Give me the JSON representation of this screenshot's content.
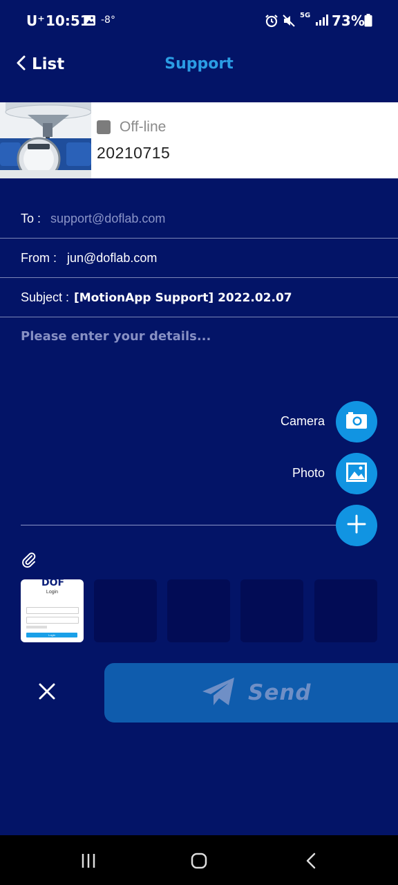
{
  "status_bar": {
    "carrier": "U⁺",
    "time": "10:51",
    "temperature": "-8°",
    "network": "5G",
    "battery": "73%"
  },
  "header": {
    "back_label": "List",
    "title": "Support"
  },
  "device": {
    "status": "Off-line",
    "id": "20210715"
  },
  "form": {
    "to_label": "To :",
    "to_value": "support@doflab.com",
    "from_label": "From :",
    "from_value": "jun@doflab.com",
    "subject_label": "Subject :",
    "subject_value": "[MotionApp Support] 2022.02.07",
    "details_placeholder": "Please enter your details..."
  },
  "actions": {
    "camera_label": "Camera",
    "photo_label": "Photo"
  },
  "attachments": {
    "thumb_logo": "DOF",
    "thumb_title": "Login",
    "thumb_button": "Login"
  },
  "send": {
    "label": "Send"
  },
  "colors": {
    "background": "#031467",
    "accent": "#1194e2",
    "title": "#2b9de4",
    "send_button": "#0f5cad"
  }
}
